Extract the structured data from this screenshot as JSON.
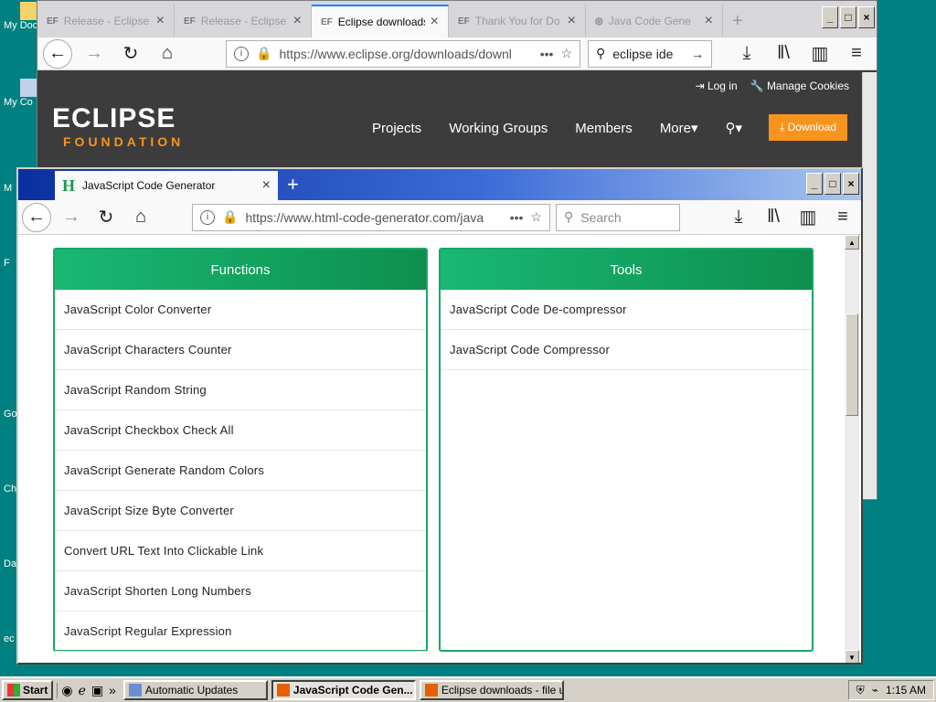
{
  "desktop": {
    "icons": [
      "My Doc",
      "My Co",
      "M",
      "F",
      "Go",
      "Ch",
      "Da",
      "ec"
    ]
  },
  "back_window": {
    "tabs": [
      {
        "icon": "EF",
        "title": "Release - Eclipse"
      },
      {
        "icon": "EF",
        "title": "Release - Eclipse"
      },
      {
        "icon": "EF",
        "title": "Eclipse downloads"
      },
      {
        "icon": "EF",
        "title": "Thank You for Do"
      },
      {
        "icon": "",
        "title": "Java Code Gene"
      }
    ],
    "url": "https://www.eclipse.org/downloads/downl",
    "search_value": "eclipse ide",
    "eclipse": {
      "logo_main": "ECLIPSE",
      "logo_sub": "FOUNDATION",
      "login": "Log in",
      "manage_cookies": "Manage Cookies",
      "nav": [
        "Projects",
        "Working Groups",
        "Members",
        "More▾"
      ],
      "download": "Download"
    }
  },
  "front_window": {
    "tab_title": "JavaScript Code Generator",
    "url": "https://www.html-code-generator.com/java",
    "search_placeholder": "Search",
    "functions": {
      "title": "Functions",
      "items": [
        "JavaScript Color Converter",
        "JavaScript Characters Counter",
        "JavaScript Random String",
        "JavaScript Checkbox Check All",
        "JavaScript Generate Random Colors",
        "JavaScript Size Byte Converter",
        "Convert URL Text Into Clickable Link",
        "JavaScript Shorten Long Numbers",
        "JavaScript Regular Expression"
      ]
    },
    "tools": {
      "title": "Tools",
      "items": [
        "JavaScript Code De-compressor",
        "JavaScript Code Compressor"
      ]
    }
  },
  "taskbar": {
    "start": "Start",
    "tasks": [
      "Automatic Updates",
      "JavaScript Code Gen...",
      "Eclipse downloads - file u..."
    ],
    "clock": "1:15 AM"
  },
  "colors": {
    "desktop": "#008080",
    "eclipse_orange": "#f7941e",
    "panel_green": "#1aa765"
  }
}
